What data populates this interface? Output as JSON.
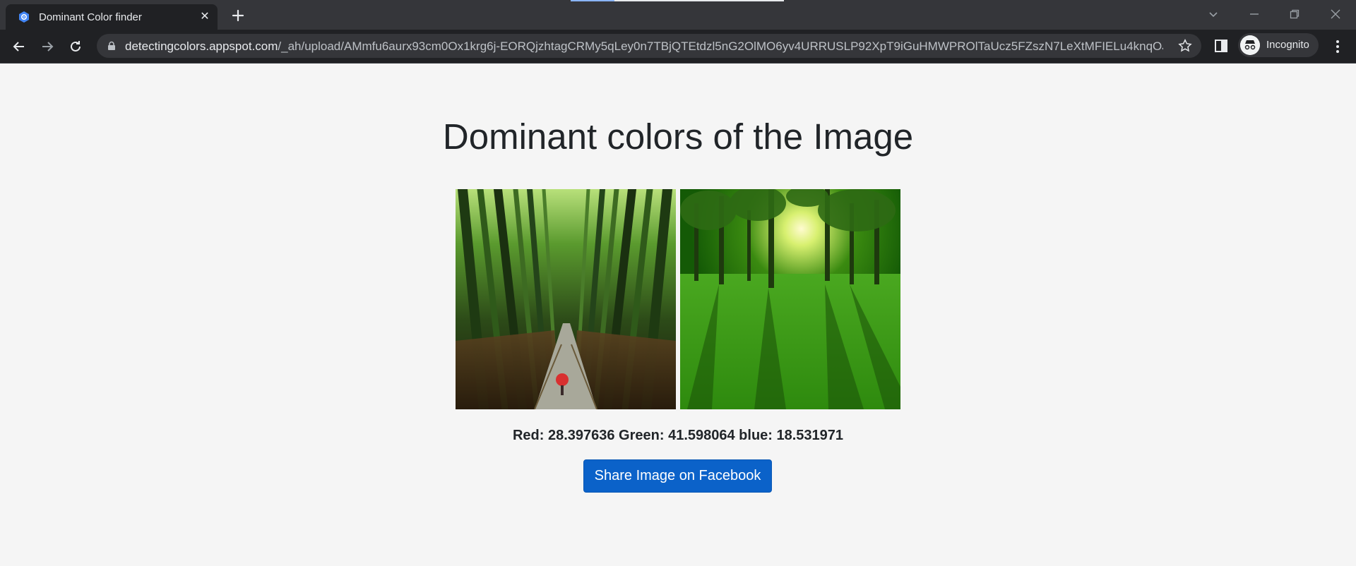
{
  "browser": {
    "tab_title": "Dominant Color finder",
    "tab_close_glyph": "✕",
    "new_tab_icon": "plus-icon",
    "url_host": "detectingcolors.appspot.com",
    "url_path": "/_ah/upload/AMmfu6aurx93cm0Ox1krg6j-EORQjzhtagCRMy5qLey0n7TBjQTEtdzl5nG2OlMO6yv4URRUSLP92XpT9iGuHMWPROlTaUcz5FZszN7LeXtMFIELu4knqOJ...",
    "profile_label": "Incognito",
    "icons": [
      "back-arrow-icon",
      "forward-arrow-icon",
      "reload-icon",
      "lock-icon",
      "star-icon",
      "side-panel-icon",
      "incognito-icon",
      "kebab-menu-icon",
      "minimize-icon",
      "restore-icon",
      "close-window-icon",
      "tab-search-icon"
    ]
  },
  "page": {
    "heading": "Dominant colors of the Image",
    "rgb_result": "Red: 28.397636 Green: 41.598064 blue: 18.531971",
    "share_button_label": "Share Image on Facebook",
    "colors": {
      "page_bg": "#f5f5f5",
      "button_bg": "#0b62c9",
      "chrome_dark": "#202124"
    }
  }
}
